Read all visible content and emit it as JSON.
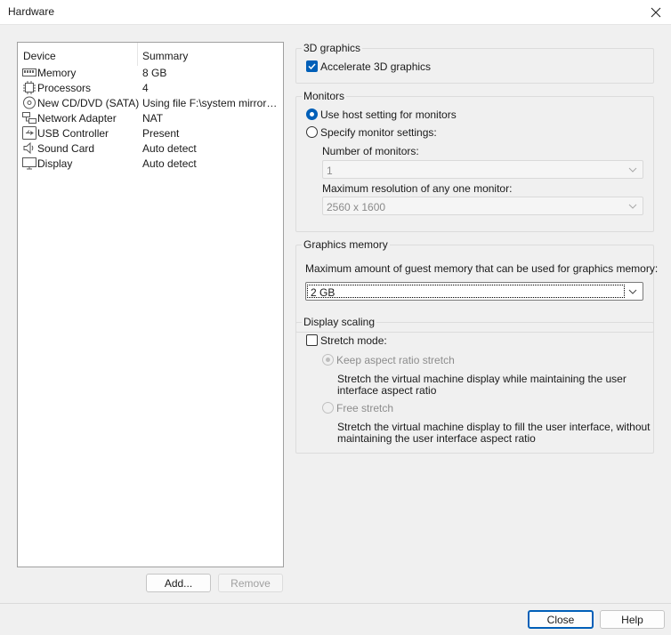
{
  "window": {
    "title": "Hardware"
  },
  "devices": {
    "columns": {
      "device": "Device",
      "summary": "Summary"
    },
    "items": [
      {
        "icon": "memory-icon",
        "name": "Memory",
        "summary": "8 GB"
      },
      {
        "icon": "processor-icon",
        "name": "Processors",
        "summary": "4"
      },
      {
        "icon": "cd-dvd-icon",
        "name": "New CD/DVD (SATA)",
        "summary": "Using file F:\\system mirrors\\li..."
      },
      {
        "icon": "network-adapter-icon",
        "name": "Network Adapter",
        "summary": "NAT"
      },
      {
        "icon": "usb-icon",
        "name": "USB Controller",
        "summary": "Present"
      },
      {
        "icon": "speaker-icon",
        "name": "Sound Card",
        "summary": "Auto detect"
      },
      {
        "icon": "monitor-icon",
        "name": "Display",
        "summary": "Auto detect"
      }
    ],
    "add_label": "Add...",
    "remove_label": "Remove"
  },
  "graphics3d": {
    "legend": "3D graphics",
    "accelerate_label": "Accelerate 3D graphics",
    "accelerate_checked": true
  },
  "monitors": {
    "legend": "Monitors",
    "use_host_label": "Use host setting for monitors",
    "specify_label": "Specify monitor settings:",
    "selected": "use_host",
    "number_label": "Number of monitors:",
    "number_value": "1",
    "max_res_label": "Maximum resolution of any one monitor:",
    "max_res_value": "2560 x 1600"
  },
  "graphics_memory": {
    "legend": "Graphics memory",
    "description": "Maximum amount of guest memory that can be used for graphics memory:",
    "value": "2 GB"
  },
  "display_scaling": {
    "legend": "Display scaling",
    "stretch_label": "Stretch mode:",
    "stretch_checked": false,
    "keep_aspect_label": "Keep aspect ratio stretch",
    "keep_aspect_desc": "Stretch the virtual machine display while maintaining the user interface aspect ratio",
    "free_label": "Free stretch",
    "free_desc": "Stretch the virtual machine display to fill the user interface, without maintaining the user interface aspect ratio"
  },
  "footer": {
    "close_label": "Close",
    "help_label": "Help"
  },
  "colors": {
    "accent": "#005fb8",
    "window_bg": "#f0f0f0"
  }
}
